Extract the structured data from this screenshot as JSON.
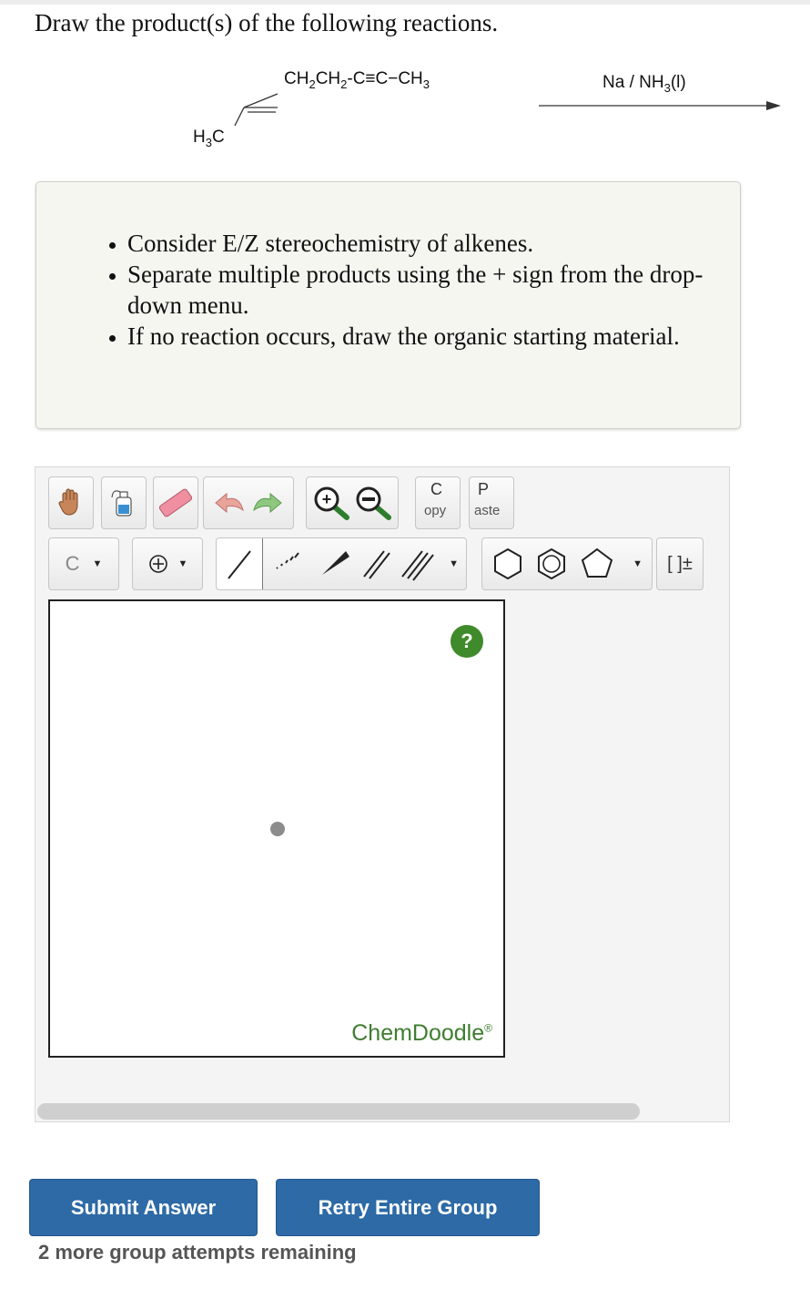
{
  "question": {
    "title": "Draw the product(s) of the following reactions."
  },
  "reaction": {
    "chain_parts": [
      "CH",
      "2",
      "CH",
      "2",
      "-C≡C−CH",
      "3"
    ],
    "h3c_parts": [
      "H",
      "3",
      "C"
    ],
    "reagent_parts": [
      "Na / NH",
      "3",
      "(l)"
    ]
  },
  "instructions": [
    "Consider E/Z stereochemistry of alkenes.",
    "Separate multiple products using the + sign from the drop-down menu.",
    "If no reaction occurs, draw the organic starting material."
  ],
  "toolbar": {
    "copy": {
      "big": "C",
      "small": "opy"
    },
    "paste": {
      "big": "P",
      "small": "aste"
    },
    "atom_label": "C",
    "bracket_label": "[ ]±"
  },
  "canvas": {
    "help_label": "?",
    "brand": "ChemDoodle",
    "brand_mark": "®"
  },
  "actions": {
    "submit": "Submit Answer",
    "retry": "Retry Entire Group",
    "attempts": "2 more group attempts remaining"
  },
  "colors": {
    "button_blue": "#2d6aa6",
    "help_green": "#3f8a2a",
    "brand_green": "#3f7d30"
  }
}
